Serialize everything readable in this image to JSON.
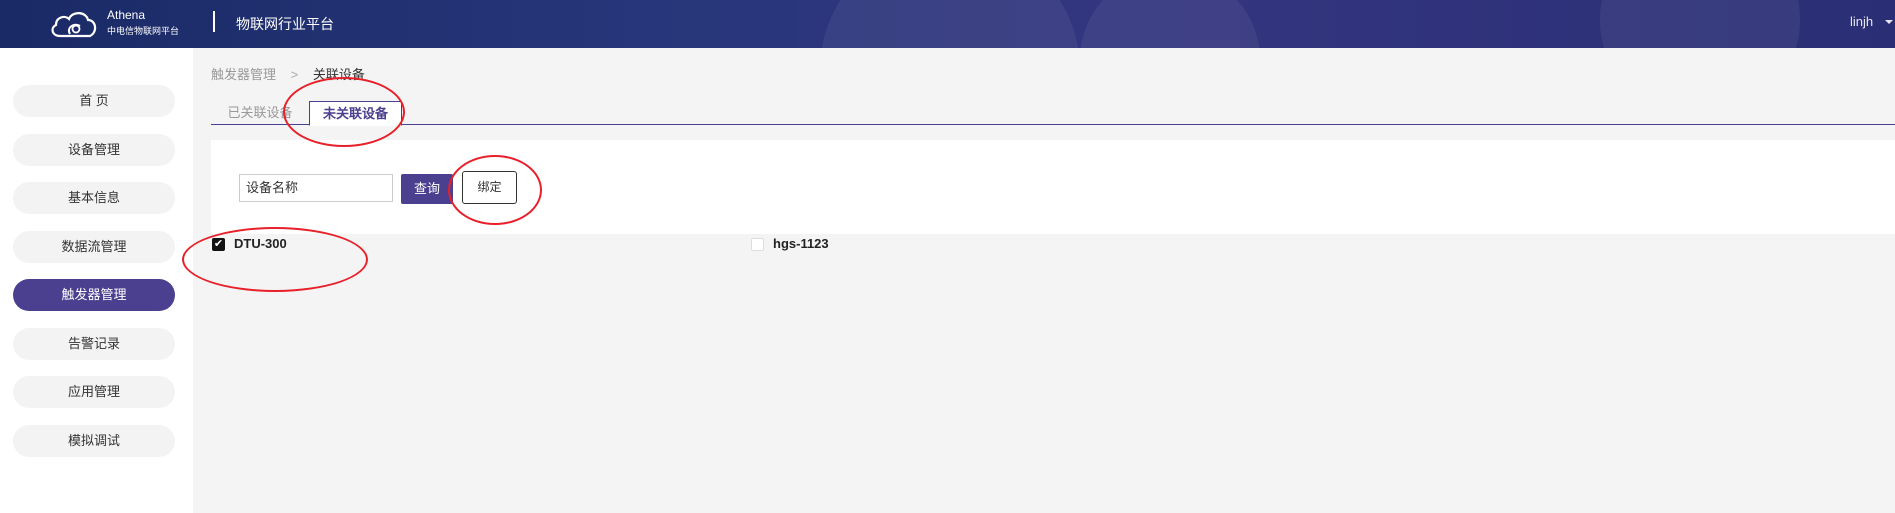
{
  "header": {
    "brand_en": "Athena",
    "brand_cn": "中电信物联网平台",
    "app_title": "物联网行业平台",
    "user": "linjh"
  },
  "sidebar": {
    "items": [
      {
        "label": "首 页",
        "active": false
      },
      {
        "label": "设备管理",
        "active": false
      },
      {
        "label": "基本信息",
        "active": false
      },
      {
        "label": "数据流管理",
        "active": false
      },
      {
        "label": "触发器管理",
        "active": true
      },
      {
        "label": "告警记录",
        "active": false
      },
      {
        "label": "应用管理",
        "active": false
      },
      {
        "label": "模拟调试",
        "active": false
      }
    ]
  },
  "breadcrumb": {
    "parent": "触发器管理",
    "separator": ">",
    "current": "关联设备"
  },
  "tabs": [
    {
      "label": "已关联设备",
      "active": false
    },
    {
      "label": "未关联设备",
      "active": true
    }
  ],
  "filter": {
    "search_value": "设备名称",
    "query_label": "查询",
    "bind_label": "绑定"
  },
  "devices": [
    {
      "name": "DTU-300",
      "checked": true
    },
    {
      "name": "hgs-1123",
      "checked": false
    }
  ],
  "colors": {
    "accent": "#4b3f8f",
    "annotation": "#e8202a",
    "header_bg": "#27367a"
  }
}
